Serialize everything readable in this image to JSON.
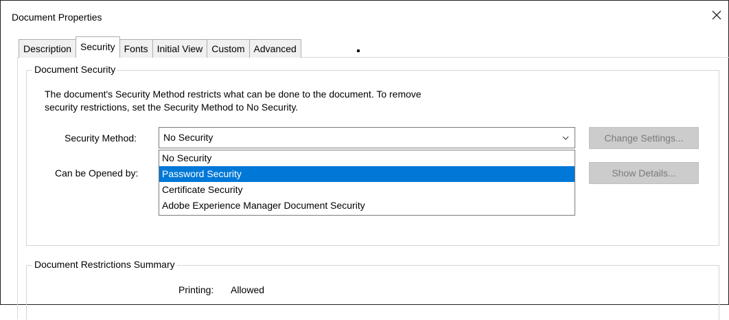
{
  "window": {
    "title": "Document Properties"
  },
  "tabs": [
    {
      "label": "Description"
    },
    {
      "label": "Security"
    },
    {
      "label": "Fonts"
    },
    {
      "label": "Initial View"
    },
    {
      "label": "Custom"
    },
    {
      "label": "Advanced"
    }
  ],
  "active_tab": "Security",
  "document_security": {
    "title": "Document Security",
    "description_line1": "The document's Security Method restricts what can be done to the document. To remove",
    "description_line2": "security restrictions, set the Security Method to No Security.",
    "security_method_label": "Security Method:",
    "security_method_value": "No Security",
    "security_method_options": [
      "No Security",
      "Password Security",
      "Certificate Security",
      "Adobe Experience Manager Document Security"
    ],
    "highlighted_option": "Password Security",
    "can_be_opened_label": "Can be Opened by:",
    "change_settings_label": "Change Settings...",
    "show_details_label": "Show Details..."
  },
  "restrictions": {
    "title": "Document Restrictions Summary",
    "printing_label": "Printing:",
    "printing_value": "Allowed"
  },
  "colors": {
    "highlight": "#0078d7",
    "disabled_button": "#cccccc"
  },
  "icons": {
    "close": "close-icon",
    "dropdown": "chevron-down-icon"
  }
}
